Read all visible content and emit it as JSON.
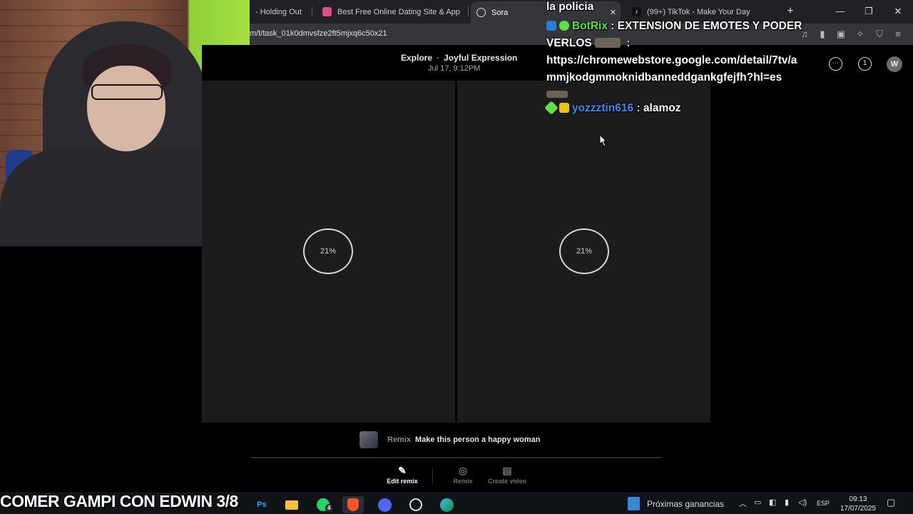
{
  "browser": {
    "tabs": [
      {
        "label": "- Holding Out",
        "active": false
      },
      {
        "label": "Best Free Online Dating Site & App",
        "active": false
      },
      {
        "label": "Sora",
        "active": true
      },
      {
        "label": "(99+) TikTok - Make Your Day",
        "active": false
      }
    ],
    "new_tab_symbol": "+",
    "url": "m/t/task_01k0dmvsfze2ft5mjxq6c50x21",
    "window_controls": {
      "minimize": "—",
      "restore": "❐",
      "close": "✕"
    }
  },
  "page": {
    "breadcrumb_section": "Explore",
    "breadcrumb_title": "Joyful Expression",
    "date": "Jul 17, 9:12PM",
    "header_icons": {
      "more": "⋯",
      "count": "1"
    },
    "avatar_letter": "W",
    "progress": [
      {
        "label": "21%",
        "value": 0.21
      },
      {
        "label": "21%",
        "value": 0.21
      }
    ],
    "remix_label": "Remix",
    "prompt": "Make this person a happy woman",
    "actions": [
      {
        "label": "Edit remix",
        "icon": "pencil-icon",
        "active": true
      },
      {
        "label": "Remix",
        "icon": "remix-icon",
        "active": false
      },
      {
        "label": "Create video",
        "icon": "film-icon",
        "active": false
      }
    ]
  },
  "chat": {
    "line1": "la policia",
    "bot_name": "BotRix",
    "bot_message_1": ": EXTENSION DE EMOTES Y PODER",
    "bot_message_2": "VERLOS",
    "bot_message_colon": ":",
    "bot_link_1": "https://chromewebstore.google.com/detail/7tv/a",
    "bot_link_2": "mmjkodgmmoknidbanneddgankgfejfh?hl=es",
    "user_name": "yozzztin616",
    "user_message": ": alamoz"
  },
  "overlay_subtitle": "COMER GAMPI CON EDWIN 3/8",
  "taskbar": {
    "apps": [
      "Ps",
      "Files",
      "WhatsApp",
      "Brave",
      "Discord",
      "Obs",
      "Edge"
    ],
    "whatsapp_badge": "4",
    "weather_label": "Próximas ganancias",
    "language": "ESP",
    "time": "09:13",
    "date": "17/07/2025"
  },
  "colors": {
    "panel_bg": "#1c1c1c",
    "bot_name_color": "#5ee04a",
    "user_name_color": "#3b8cf0",
    "taskbar_bg": "#101418"
  }
}
